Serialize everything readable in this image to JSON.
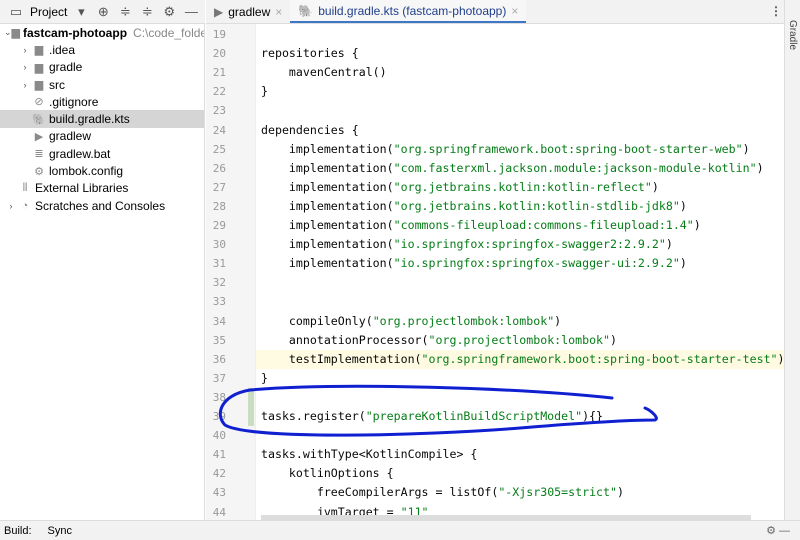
{
  "project_toolbar": {
    "title": "Project"
  },
  "tree": [
    {
      "label": "fastcam-photoapp",
      "path": "C:\\code_folder",
      "indent": 0,
      "arrow": "v",
      "icon": "module-folder-icon"
    },
    {
      "label": ".idea",
      "indent": 1,
      "arrow": ">",
      "icon": "folder-icon"
    },
    {
      "label": "gradle",
      "indent": 1,
      "arrow": ">",
      "icon": "folder-icon"
    },
    {
      "label": "src",
      "indent": 1,
      "arrow": ">",
      "icon": "folder-icon"
    },
    {
      "label": ".gitignore",
      "indent": 1,
      "arrow": "",
      "icon": "ignore-file-icon"
    },
    {
      "label": "build.gradle.kts",
      "indent": 1,
      "arrow": "",
      "icon": "gradle-kts-icon",
      "selected": true
    },
    {
      "label": "gradlew",
      "indent": 1,
      "arrow": "",
      "icon": "script-icon"
    },
    {
      "label": "gradlew.bat",
      "indent": 1,
      "arrow": "",
      "icon": "bat-file-icon"
    },
    {
      "label": "lombok.config",
      "indent": 1,
      "arrow": "",
      "icon": "config-icon"
    },
    {
      "label": "External Libraries",
      "indent": 0,
      "arrow": "",
      "icon": "libraries-icon"
    },
    {
      "label": "Scratches and Consoles",
      "indent": 0,
      "arrow": ">",
      "icon": "scratches-icon"
    }
  ],
  "tabs": [
    {
      "label": "gradlew"
    },
    {
      "label": "build.gradle.kts (fastcam-photoapp)",
      "active": true
    }
  ],
  "side_panel": "Gradle",
  "code": [
    {
      "n": "19",
      "t": []
    },
    {
      "n": "20",
      "t": [
        [
          "repositories {",
          ""
        ]
      ]
    },
    {
      "n": "21",
      "t": [
        [
          "    mavenCentral()",
          ""
        ]
      ]
    },
    {
      "n": "22",
      "t": [
        [
          "}",
          ""
        ]
      ]
    },
    {
      "n": "23",
      "t": []
    },
    {
      "n": "24",
      "t": [
        [
          "dependencies {",
          ""
        ]
      ]
    },
    {
      "n": "25",
      "t": [
        [
          "    implementation(",
          ""
        ],
        [
          "\"org.springframework.boot:spring-boot-starter-web\"",
          "s"
        ],
        [
          ")",
          ""
        ]
      ]
    },
    {
      "n": "26",
      "t": [
        [
          "    implementation(",
          ""
        ],
        [
          "\"com.fasterxml.jackson.module:jackson-module-kotlin\"",
          "s"
        ],
        [
          ")",
          ""
        ]
      ]
    },
    {
      "n": "27",
      "t": [
        [
          "    implementation(",
          ""
        ],
        [
          "\"org.jetbrains.kotlin:kotlin-reflect\"",
          "s"
        ],
        [
          ")",
          ""
        ]
      ]
    },
    {
      "n": "28",
      "t": [
        [
          "    implementation(",
          ""
        ],
        [
          "\"org.jetbrains.kotlin:kotlin-stdlib-jdk8\"",
          "s"
        ],
        [
          ")",
          ""
        ]
      ]
    },
    {
      "n": "29",
      "t": [
        [
          "    implementation(",
          ""
        ],
        [
          "\"commons-fileupload:commons-fileupload:1.4\"",
          "s"
        ],
        [
          ")",
          ""
        ]
      ]
    },
    {
      "n": "30",
      "t": [
        [
          "    implementation(",
          ""
        ],
        [
          "\"io.springfox:springfox-swagger2:2.9.2\"",
          "s"
        ],
        [
          ")",
          ""
        ]
      ]
    },
    {
      "n": "31",
      "t": [
        [
          "    implementation(",
          ""
        ],
        [
          "\"io.springfox:springfox-swagger-ui:2.9.2\"",
          "s"
        ],
        [
          ")",
          ""
        ]
      ]
    },
    {
      "n": "32",
      "t": []
    },
    {
      "n": "33",
      "t": []
    },
    {
      "n": "34",
      "t": [
        [
          "    compileOnly(",
          ""
        ],
        [
          "\"org.projectlombok:lombok\"",
          "s"
        ],
        [
          ")",
          ""
        ]
      ]
    },
    {
      "n": "35",
      "t": [
        [
          "    annotationProcessor(",
          ""
        ],
        [
          "\"org.projectlombok:lombok\"",
          "s"
        ],
        [
          ")",
          ""
        ]
      ]
    },
    {
      "n": "36",
      "t": [
        [
          "    testImplementation(",
          ""
        ],
        [
          "\"org.springframework.boot:spring-boot-starter-test\"",
          "s"
        ],
        [
          ")",
          ""
        ]
      ],
      "current": true
    },
    {
      "n": "37",
      "t": [
        [
          "}",
          ""
        ]
      ]
    },
    {
      "n": "38",
      "t": [],
      "modified": true
    },
    {
      "n": "39",
      "t": [
        [
          "tasks.register(",
          ""
        ],
        [
          "\"prepareKotlinBuildScriptModel\"",
          "s"
        ],
        [
          "){}",
          ""
        ]
      ],
      "modified": true
    },
    {
      "n": "40",
      "t": []
    },
    {
      "n": "41",
      "t": [
        [
          "tasks.withType<KotlinCompile> {",
          ""
        ]
      ]
    },
    {
      "n": "42",
      "t": [
        [
          "    kotlinOptions {",
          ""
        ]
      ]
    },
    {
      "n": "43",
      "t": [
        [
          "        freeCompilerArgs = listOf(",
          ""
        ],
        [
          "\"-Xjsr305=strict\"",
          "s"
        ],
        [
          ")",
          ""
        ]
      ]
    },
    {
      "n": "44",
      "t": [
        [
          "        jvmTarget = ",
          ""
        ],
        [
          "\"11\"",
          "s"
        ]
      ]
    }
  ],
  "bottom": {
    "build_label": "Build:",
    "sync_label": "Sync"
  },
  "colors": {
    "string": "#067d17",
    "annotation": "#1020d0",
    "accent": "#3d78c8"
  }
}
